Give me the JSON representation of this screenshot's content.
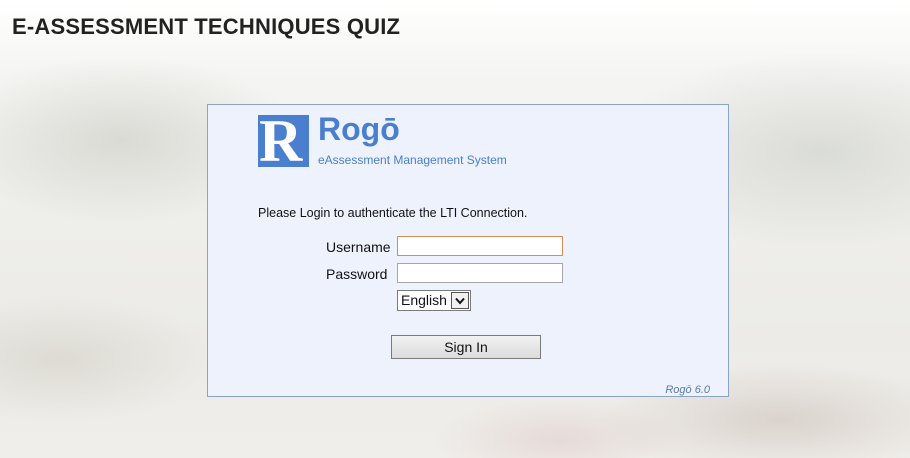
{
  "page": {
    "title": "E-ASSESSMENT TECHNIQUES QUIZ"
  },
  "brand": {
    "logo_letter": "R",
    "name": "Rogō",
    "tagline": "eAssessment Management System",
    "accent_color": "#4a7fd0"
  },
  "login": {
    "message": "Please Login to authenticate the LTI Connection.",
    "username_label": "Username",
    "username_value": "",
    "password_label": "Password",
    "password_value": "",
    "language_selected": "English",
    "sign_in_label": "Sign In"
  },
  "footer": {
    "version": "Rogō 6.0"
  },
  "icons": {
    "select_arrow": "chevron-down-icon"
  }
}
